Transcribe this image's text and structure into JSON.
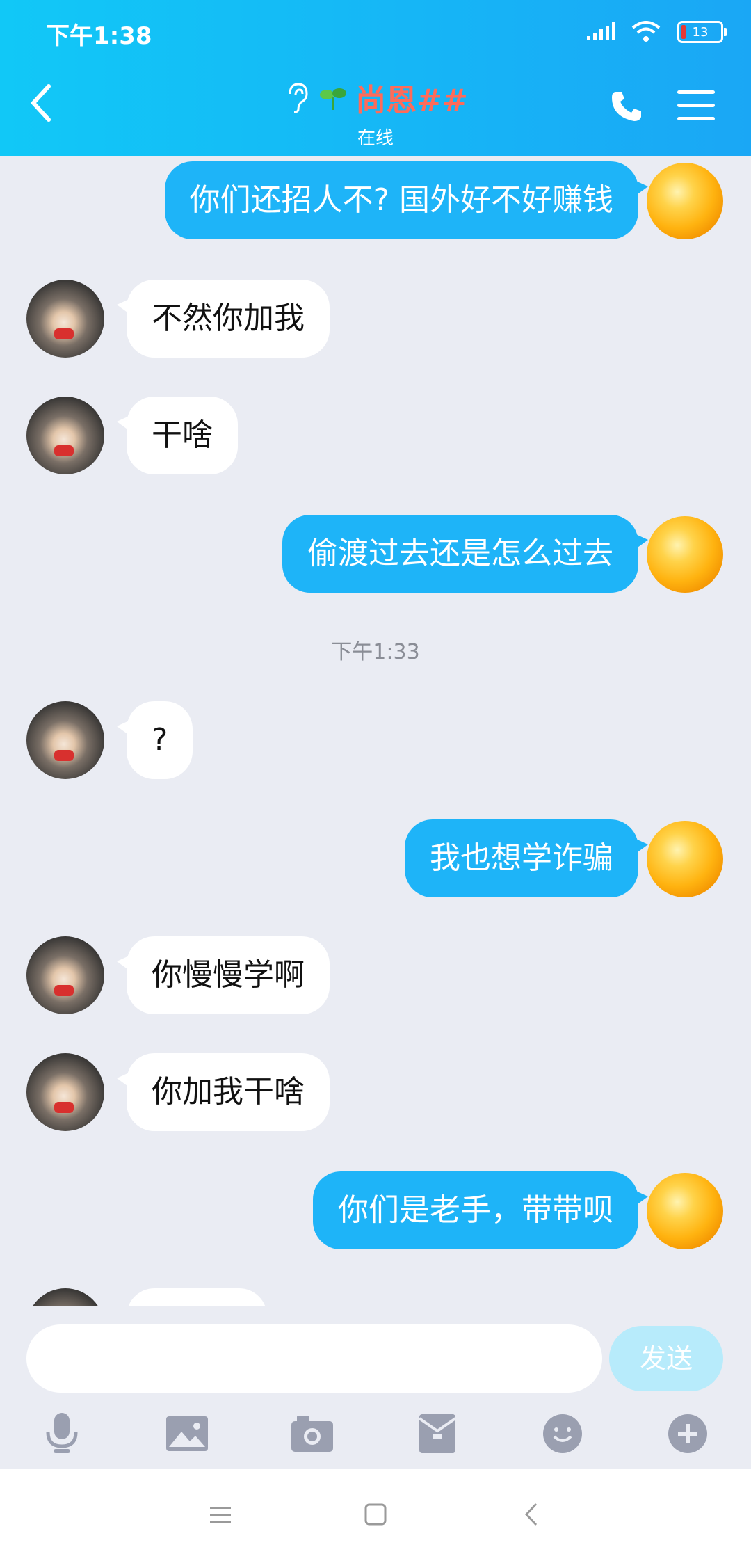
{
  "status_bar": {
    "time": "下午1:38",
    "battery": "13"
  },
  "header": {
    "title": "尚恩##",
    "subtitle": "在线"
  },
  "messages": [
    {
      "side": "right",
      "text": "你们还招人不? 国外好不好赚钱"
    },
    {
      "side": "left",
      "text": "不然你加我"
    },
    {
      "side": "left",
      "text": "干啥"
    },
    {
      "side": "right",
      "text": "偷渡过去还是怎么过去"
    },
    {
      "side": "time",
      "text": "下午1:33"
    },
    {
      "side": "left",
      "text": "?"
    },
    {
      "side": "right",
      "text": "我也想学诈骗"
    },
    {
      "side": "left",
      "text": "你慢慢学啊"
    },
    {
      "side": "left",
      "text": "你加我干啥"
    },
    {
      "side": "right",
      "text": "你们是老手，带带呗"
    }
  ],
  "input": {
    "value": "",
    "send_label": "发送"
  },
  "toolbar_icons": [
    "microphone-icon",
    "image-icon",
    "camera-icon",
    "red-packet-icon",
    "emoji-icon",
    "plus-icon"
  ],
  "colors": {
    "header": "#1aa7f5",
    "bubble_self": "#1eb4f8",
    "bubble_other": "#ffffff",
    "title": "#ff6b5a"
  }
}
